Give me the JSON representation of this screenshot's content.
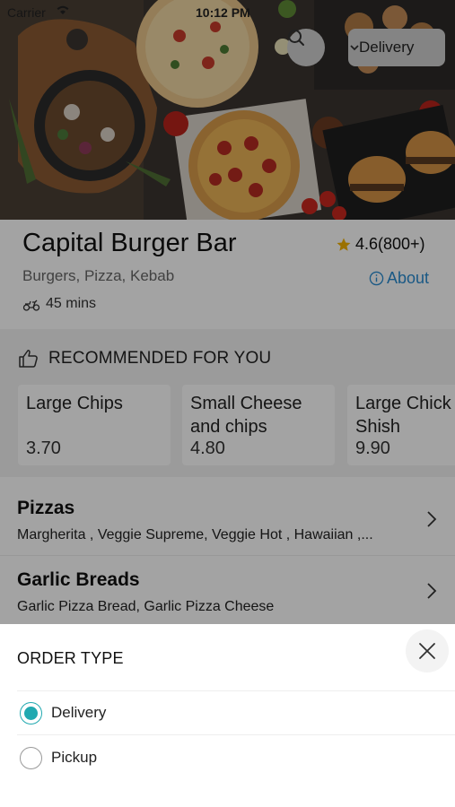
{
  "status_bar": {
    "carrier": "Carrier",
    "time": "10:12 PM"
  },
  "header": {
    "order_type_selected": "Delivery"
  },
  "restaurant": {
    "name": "Capital Burger Bar",
    "rating": "4.6(800+)",
    "cuisines": "Burgers, Pizza, Kebab",
    "about_label": "About",
    "delivery_time": "45 mins"
  },
  "recommended": {
    "title": "RECOMMENDED FOR YOU",
    "items": [
      {
        "name": "Large Chips",
        "price": "3.70"
      },
      {
        "name": "Small Cheese and chips",
        "name_line1": "Small Cheese",
        "name_line2": "and chips",
        "price": "4.80"
      },
      {
        "name": "Large Chicken Shish",
        "name_line1": "Large Chick",
        "name_line2": "Shish",
        "price": "9.90"
      }
    ]
  },
  "categories": [
    {
      "name": "Pizzas",
      "description": "Margherita , Veggie Supreme, Veggie Hot , Hawaiian ,..."
    },
    {
      "name": "Garlic Breads",
      "description": "Garlic Pizza Bread, Garlic Pizza Cheese"
    }
  ],
  "order_type_sheet": {
    "title": "ORDER TYPE",
    "options": [
      {
        "label": "Delivery",
        "selected": true
      },
      {
        "label": "Pickup",
        "selected": false
      }
    ]
  },
  "colors": {
    "accent": "#21a9b0",
    "link": "#2a8bd0",
    "star": "#f2b100"
  }
}
